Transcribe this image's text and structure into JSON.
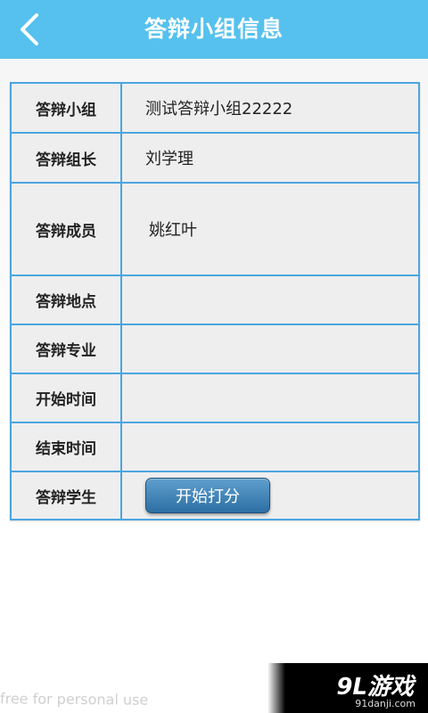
{
  "header": {
    "title": "答辩小组信息",
    "back_icon": "chevron-left-icon"
  },
  "rows": [
    {
      "label": "答辩小组",
      "value": "测试答辩小组22222"
    },
    {
      "label": "答辩组长",
      "value": "刘学理"
    },
    {
      "label": "答辩成员",
      "value": "姚红叶"
    },
    {
      "label": "答辩地点",
      "value": ""
    },
    {
      "label": "答辩专业",
      "value": ""
    },
    {
      "label": "开始时间",
      "value": ""
    },
    {
      "label": "结束时间",
      "value": ""
    },
    {
      "label": "答辩学生",
      "button": "开始打分"
    }
  ],
  "watermark": "free for personal use",
  "logo": {
    "main": "9L游戏",
    "sub": "91danji.com"
  },
  "colors": {
    "header": "#56c1ee",
    "border": "#4ba5e0",
    "button": "#2d6fa3"
  }
}
